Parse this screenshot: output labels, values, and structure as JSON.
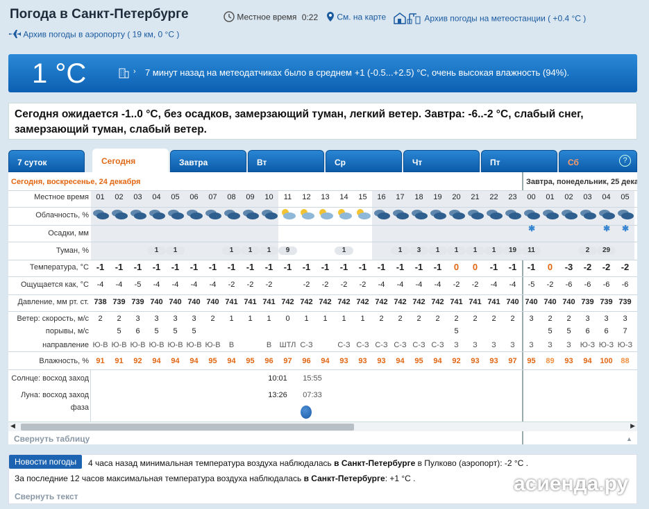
{
  "title": "Погода в Санкт-Петербурге",
  "local_time_label": "Местное время",
  "local_time": "0:22",
  "map_link": "См. на карте",
  "station_archive": "Архив погоды на метеостанции ( +0.4 °C )",
  "airport_archive": "Архив погоды в аэропорту ( 19 км, 0 °C )",
  "current_temp": "1 °C",
  "current_info": "7 минут назад на метеодатчиках было в среднем +1 (-0.5...+2.5) °C, очень высокая влажность (94%).",
  "forecast_text": "Сегодня ожидается -1..0 °C, без осадков, замерзающий туман, легкий ветер. Завтра: -6..-2 °C, слабый снег, замерзающий туман, слабый ветер.",
  "tabs": [
    "7 суток",
    "Сегодня",
    "Завтра",
    "Вт",
    "Ср",
    "Чт",
    "Пт",
    "Сб"
  ],
  "help": "?",
  "today_header": "Сегодня, воскресенье, 24 декабря",
  "tomorrow_header": "Завтра, понедельник, 25 декабря",
  "labels": {
    "time": "Местное время",
    "cloud": "Облачность, %",
    "precip": "Осадки, мм",
    "fog": "Туман, %",
    "temp": "Температура, °C",
    "feels": "Ощущается как, °C",
    "pressure": "Давление, мм рт. ст.",
    "wind_speed": "Ветер: скорость, м/с",
    "gusts": "порывы, м/с",
    "direction": "направление",
    "humidity": "Влажность, %",
    "sun": "Солнце: восход заход",
    "moon": "Луна: восход заход",
    "phase": "фаза"
  },
  "hours": [
    "01",
    "02",
    "03",
    "04",
    "05",
    "06",
    "07",
    "08",
    "09",
    "10",
    "11",
    "12",
    "13",
    "14",
    "15",
    "16",
    "17",
    "18",
    "19",
    "20",
    "21",
    "22",
    "23",
    "00",
    "01",
    "02",
    "03",
    "04",
    "05"
  ],
  "fog": [
    "",
    "",
    "",
    "1",
    "1",
    "",
    "",
    "1",
    "1",
    "1",
    "9",
    "",
    "",
    "1",
    "",
    "",
    "1",
    "3",
    "1",
    "1",
    "1",
    "1",
    "19",
    "11",
    "",
    "",
    "2",
    "29",
    ""
  ],
  "temp": [
    "-1",
    "-1",
    "-1",
    "-1",
    "-1",
    "-1",
    "-1",
    "-1",
    "-1",
    "-1",
    "-1",
    "-1",
    "-1",
    "-1",
    "-1",
    "-1",
    "-1",
    "-1",
    "-1",
    "0",
    "0",
    "-1",
    "-1",
    "-1",
    "0",
    "-3",
    "-2",
    "-2",
    "-2"
  ],
  "feels": [
    "-4",
    "-4",
    "-5",
    "-4",
    "-4",
    "-4",
    "-4",
    "-2",
    "-2",
    "-2",
    "",
    "-2",
    "-2",
    "-2",
    "-2",
    "-4",
    "-4",
    "-4",
    "-4",
    "-2",
    "-2",
    "-4",
    "-4",
    "-5",
    "-2",
    "-6",
    "-6",
    "-6",
    "-6"
  ],
  "pressure": [
    "738",
    "739",
    "739",
    "740",
    "740",
    "740",
    "740",
    "741",
    "741",
    "741",
    "742",
    "742",
    "742",
    "742",
    "742",
    "742",
    "742",
    "742",
    "742",
    "741",
    "741",
    "741",
    "740",
    "740",
    "740",
    "740",
    "739",
    "739",
    "739"
  ],
  "wind": [
    "2",
    "2",
    "3",
    "3",
    "3",
    "3",
    "2",
    "1",
    "1",
    "1",
    "0",
    "1",
    "1",
    "1",
    "1",
    "2",
    "2",
    "2",
    "2",
    "2",
    "2",
    "2",
    "2",
    "3",
    "2",
    "2",
    "3",
    "3",
    "3"
  ],
  "gusts": [
    "",
    "5",
    "6",
    "5",
    "5",
    "5",
    "",
    "",
    "",
    "",
    "",
    "",
    "",
    "",
    "",
    "",
    "",
    "",
    "",
    "5",
    "",
    "",
    "",
    "",
    "5",
    "5",
    "6",
    "6",
    "7"
  ],
  "direction": [
    "Ю-В",
    "Ю-В",
    "Ю-В",
    "Ю-В",
    "Ю-В",
    "Ю-В",
    "Ю-В",
    "В",
    "",
    "В",
    "ШТЛ",
    "С-З",
    "",
    "С-З",
    "С-З",
    "С-З",
    "С-З",
    "С-З",
    "С-З",
    "З",
    "З",
    "З",
    "З",
    "З",
    "З",
    "З",
    "Ю-З",
    "Ю-З",
    "Ю-З"
  ],
  "humidity": [
    "91",
    "91",
    "92",
    "94",
    "94",
    "94",
    "95",
    "94",
    "95",
    "96",
    "97",
    "96",
    "94",
    "93",
    "93",
    "93",
    "94",
    "95",
    "94",
    "92",
    "93",
    "93",
    "97",
    "95",
    "89",
    "93",
    "94",
    "100",
    "88"
  ],
  "sunrise": "10:01",
  "sunset": "15:55",
  "moonrise": "13:26",
  "moonset": "07:33",
  "collapse_table": "Свернуть таблицу",
  "news_button": "Новости погоды",
  "news1_a": "4 часа назад минимальная температура воздуха наблюдалась ",
  "news1_b": "в Санкт-Петербурге",
  "news1_c": " в Пулково (аэропорт): -2 °C .",
  "news2_a": "За последние 12 часов максимальная температура воздуха наблюдалась ",
  "news2_b": "в Санкт-Петербурге",
  "news2_c": ": +1 °C .",
  "collapse_text": "Свернуть текст",
  "watermark": "асиенда.ру",
  "colors": {
    "accent": "#1c64b2",
    "orange": "#e26612"
  }
}
